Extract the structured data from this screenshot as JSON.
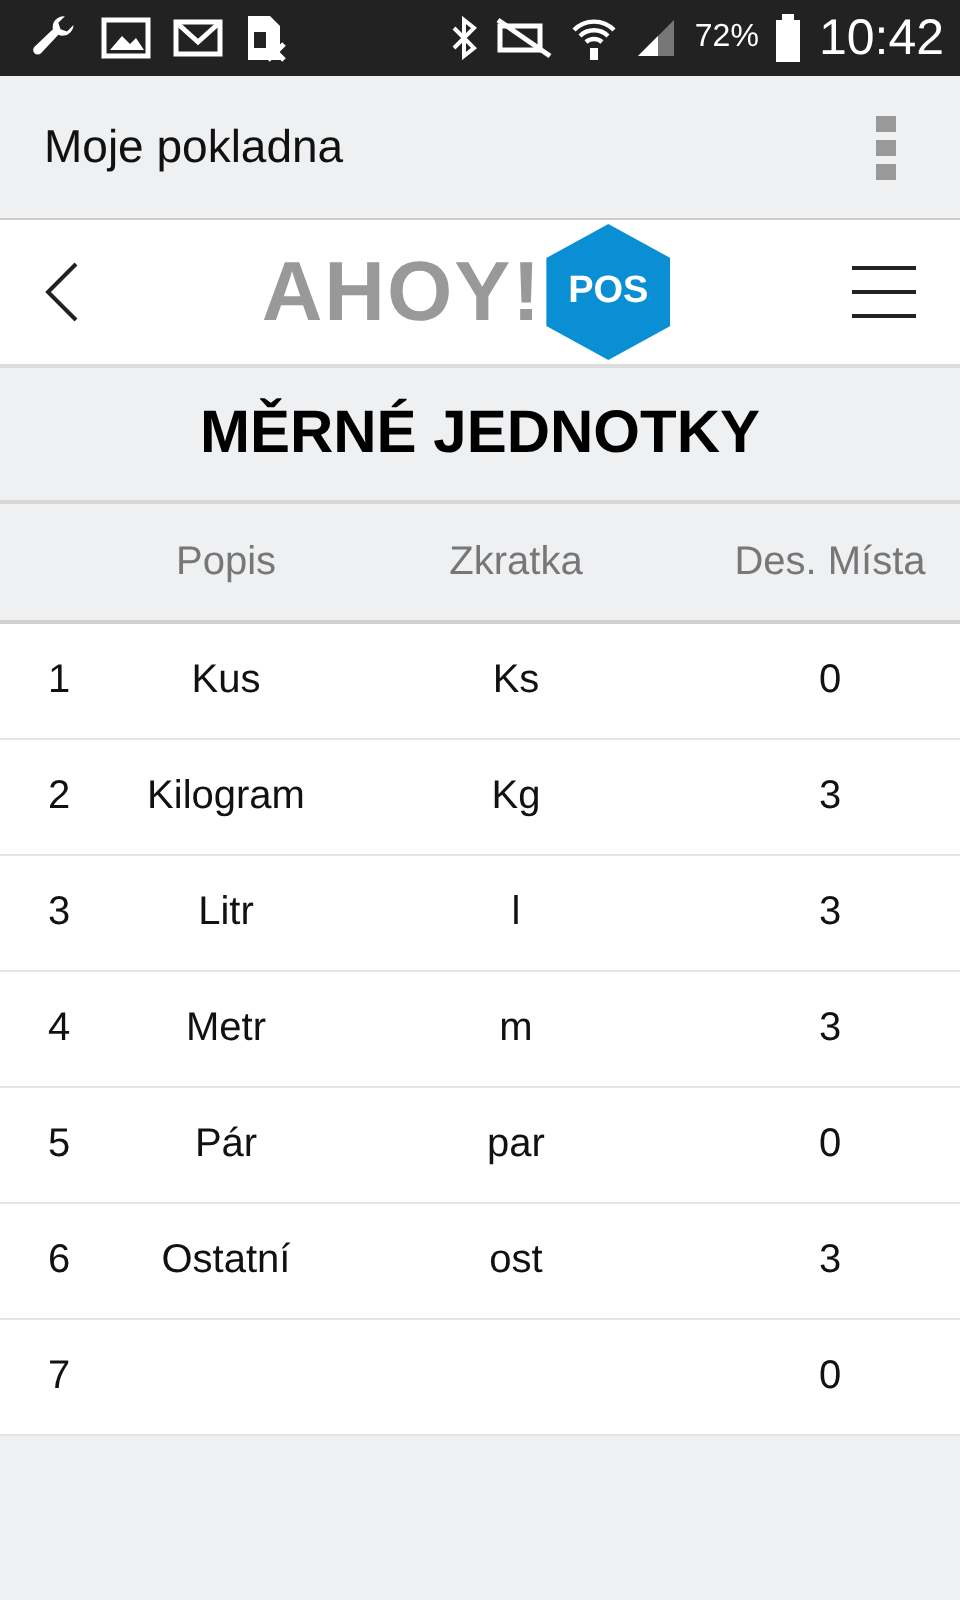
{
  "status_bar": {
    "battery": "72%",
    "time": "10:42"
  },
  "app_bar": {
    "title": "Moje pokladna"
  },
  "header": {
    "logo_text": "AHOY!",
    "logo_badge": "POS"
  },
  "page_title": "MĚRNÉ JEDNOTKY",
  "table": {
    "columns": [
      "Popis",
      "Zkratka",
      "Des. Místa"
    ],
    "rows": [
      {
        "number": "1",
        "name": "Kus",
        "abbr": "Ks",
        "decimals": "0"
      },
      {
        "number": "2",
        "name": "Kilogram",
        "abbr": "Kg",
        "decimals": "3"
      },
      {
        "number": "3",
        "name": "Litr",
        "abbr": "l",
        "decimals": "3"
      },
      {
        "number": "4",
        "name": "Metr",
        "abbr": "m",
        "decimals": "3"
      },
      {
        "number": "5",
        "name": "Pár",
        "abbr": "par",
        "decimals": "0"
      },
      {
        "number": "6",
        "name": "Ostatní",
        "abbr": "ost",
        "decimals": "3"
      },
      {
        "number": "7",
        "decimals": "0"
      }
    ]
  }
}
